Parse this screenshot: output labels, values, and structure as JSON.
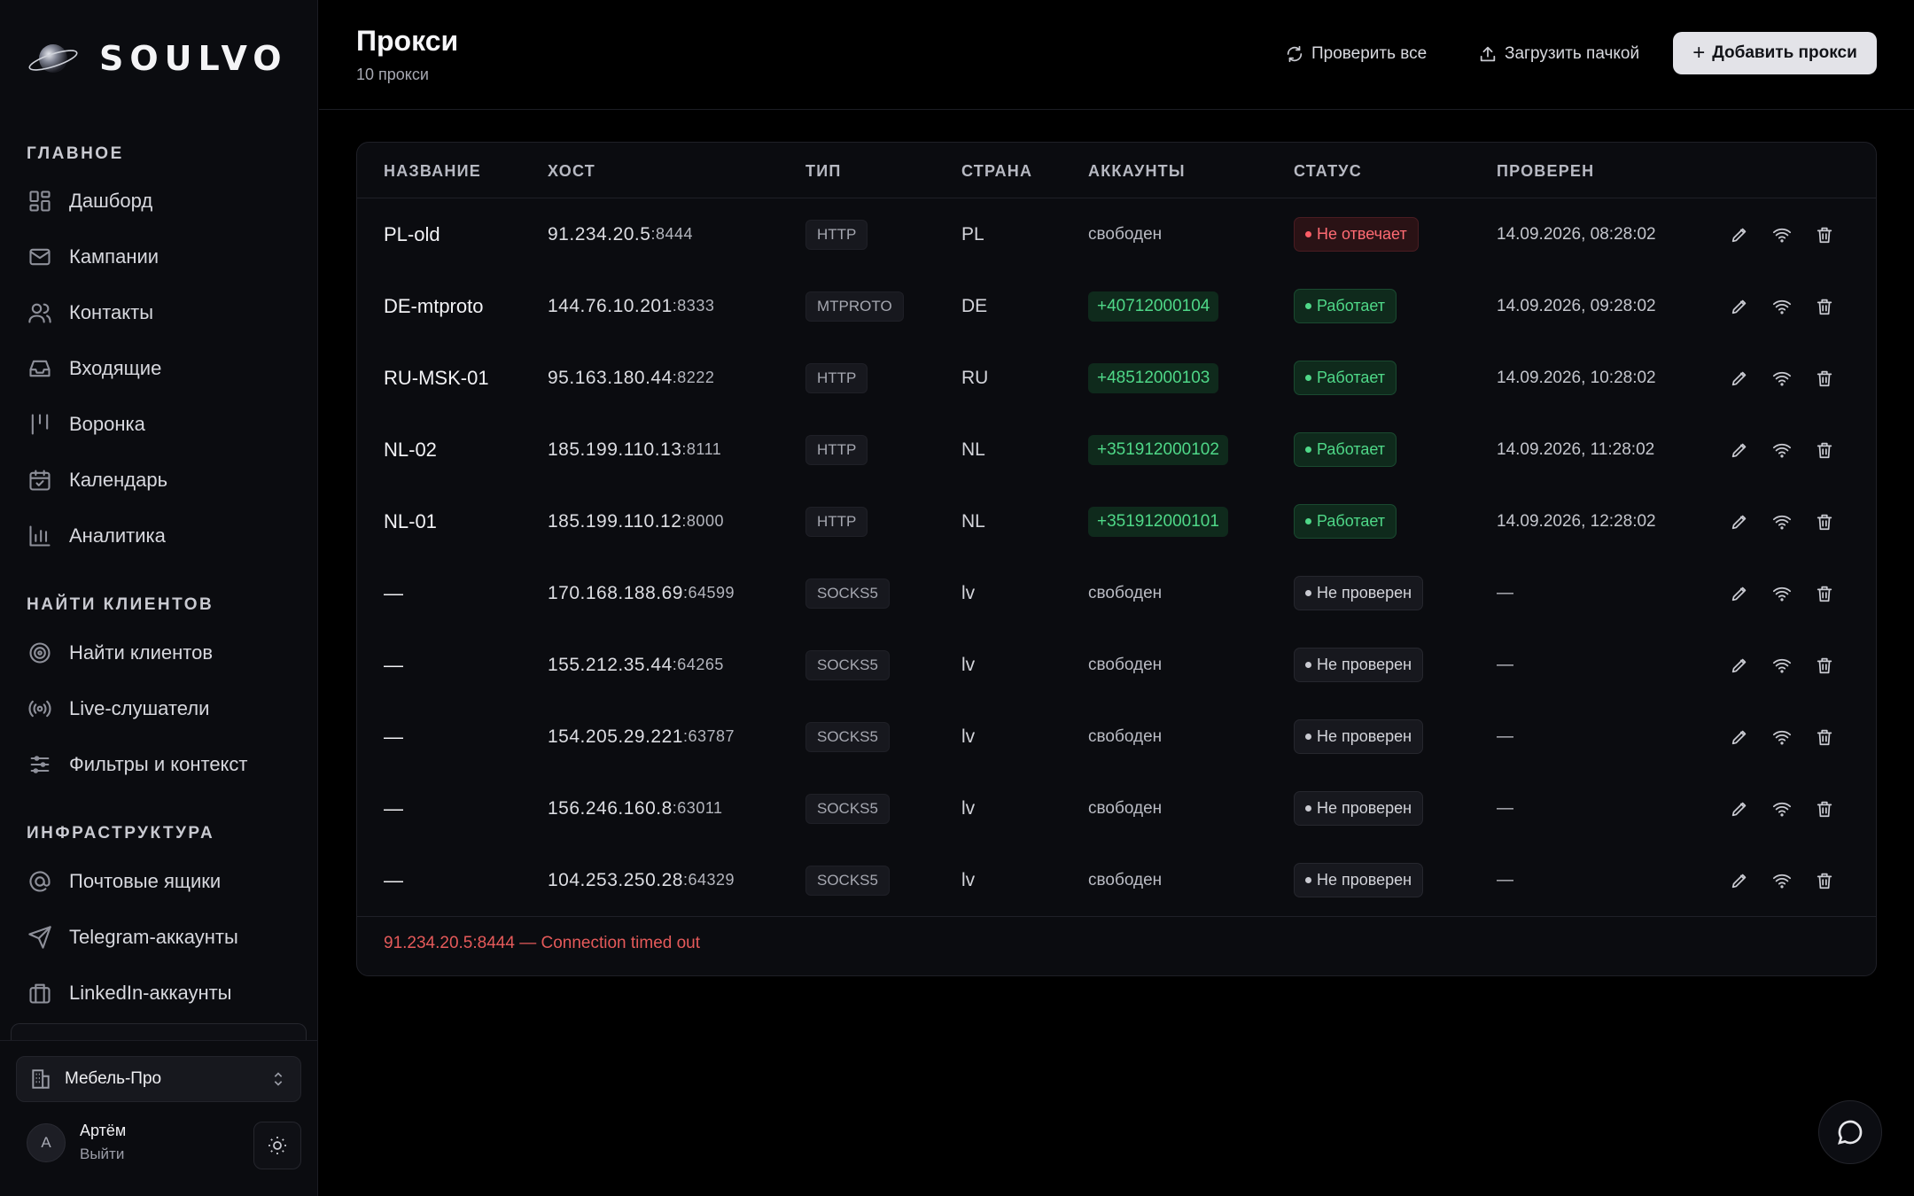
{
  "brand": {
    "name": "SOULVO"
  },
  "nav": {
    "sections": [
      {
        "title": "ГЛАВНОЕ",
        "items": [
          {
            "label": "Дашборд",
            "icon": "dashboard-icon"
          },
          {
            "label": "Кампании",
            "icon": "mail-icon"
          },
          {
            "label": "Контакты",
            "icon": "users-icon"
          },
          {
            "label": "Входящие",
            "icon": "inbox-icon"
          },
          {
            "label": "Воронка",
            "icon": "funnel-icon"
          },
          {
            "label": "Календарь",
            "icon": "calendar-icon"
          },
          {
            "label": "Аналитика",
            "icon": "chart-icon"
          }
        ]
      },
      {
        "title": "НАЙТИ КЛИЕНТОВ",
        "items": [
          {
            "label": "Найти клиентов",
            "icon": "target-icon"
          },
          {
            "label": "Live-слушатели",
            "icon": "broadcast-icon"
          },
          {
            "label": "Фильтры и контекст",
            "icon": "sliders-icon"
          }
        ]
      },
      {
        "title": "ИНФРАСТРУКТУРА",
        "items": [
          {
            "label": "Почтовые ящики",
            "icon": "at-icon"
          },
          {
            "label": "Telegram-аккаунты",
            "icon": "send-icon"
          },
          {
            "label": "LinkedIn-аккаунты",
            "icon": "briefcase-icon"
          }
        ]
      }
    ]
  },
  "workspace": {
    "name": "Мебель-Про"
  },
  "user": {
    "initial": "А",
    "name": "Артём",
    "logout": "Выйти"
  },
  "header": {
    "title": "Прокси",
    "subtitle": "10 прокси",
    "check_all": "Проверить все",
    "upload_batch": "Загрузить пачкой",
    "add_proxy": "Добавить прокси"
  },
  "table": {
    "columns": [
      "НАЗВАНИЕ",
      "ХОСТ",
      "ТИП",
      "СТРАНА",
      "АККАУНТЫ",
      "СТАТУС",
      "ПРОВЕРЕН"
    ],
    "rows": [
      {
        "name": "PL-old",
        "ip": "91.234.20.5",
        "port": ":8444",
        "type": "HTTP",
        "country": "PL",
        "account": "свободен",
        "account_assigned": false,
        "status": "Не отвечает",
        "status_kind": "error",
        "checked": "14.09.2026, 08:28:02"
      },
      {
        "name": "DE-mtproto",
        "ip": "144.76.10.201",
        "port": ":8333",
        "type": "MTPROTO",
        "country": "DE",
        "account": "+40712000104",
        "account_assigned": true,
        "status": "Работает",
        "status_kind": "ok",
        "checked": "14.09.2026, 09:28:02"
      },
      {
        "name": "RU-MSK-01",
        "ip": "95.163.180.44",
        "port": ":8222",
        "type": "HTTP",
        "country": "RU",
        "account": "+48512000103",
        "account_assigned": true,
        "status": "Работает",
        "status_kind": "ok",
        "checked": "14.09.2026, 10:28:02"
      },
      {
        "name": "NL-02",
        "ip": "185.199.110.13",
        "port": ":8111",
        "type": "HTTP",
        "country": "NL",
        "account": "+351912000102",
        "account_assigned": true,
        "status": "Работает",
        "status_kind": "ok",
        "checked": "14.09.2026, 11:28:02"
      },
      {
        "name": "NL-01",
        "ip": "185.199.110.12",
        "port": ":8000",
        "type": "HTTP",
        "country": "NL",
        "account": "+351912000101",
        "account_assigned": true,
        "status": "Работает",
        "status_kind": "ok",
        "checked": "14.09.2026, 12:28:02"
      },
      {
        "name": "—",
        "ip": "170.168.188.69",
        "port": ":64599",
        "type": "SOCKS5",
        "country": "lv",
        "account": "свободен",
        "account_assigned": false,
        "status": "Не проверен",
        "status_kind": "unchecked",
        "checked": "—"
      },
      {
        "name": "—",
        "ip": "155.212.35.44",
        "port": ":64265",
        "type": "SOCKS5",
        "country": "lv",
        "account": "свободен",
        "account_assigned": false,
        "status": "Не проверен",
        "status_kind": "unchecked",
        "checked": "—"
      },
      {
        "name": "—",
        "ip": "154.205.29.221",
        "port": ":63787",
        "type": "SOCKS5",
        "country": "lv",
        "account": "свободен",
        "account_assigned": false,
        "status": "Не проверен",
        "status_kind": "unchecked",
        "checked": "—"
      },
      {
        "name": "—",
        "ip": "156.246.160.8",
        "port": ":63011",
        "type": "SOCKS5",
        "country": "lv",
        "account": "свободен",
        "account_assigned": false,
        "status": "Не проверен",
        "status_kind": "unchecked",
        "checked": "—"
      },
      {
        "name": "—",
        "ip": "104.253.250.28",
        "port": ":64329",
        "type": "SOCKS5",
        "country": "lv",
        "account": "свободен",
        "account_assigned": false,
        "status": "Не проверен",
        "status_kind": "unchecked",
        "checked": "—"
      }
    ],
    "error_message": "91.234.20.5:8444 — Connection timed out"
  },
  "colors": {
    "accent_ok": "#4fd888",
    "accent_error": "#ff5d66",
    "background": "#000000",
    "panel": "#0b0c10"
  }
}
